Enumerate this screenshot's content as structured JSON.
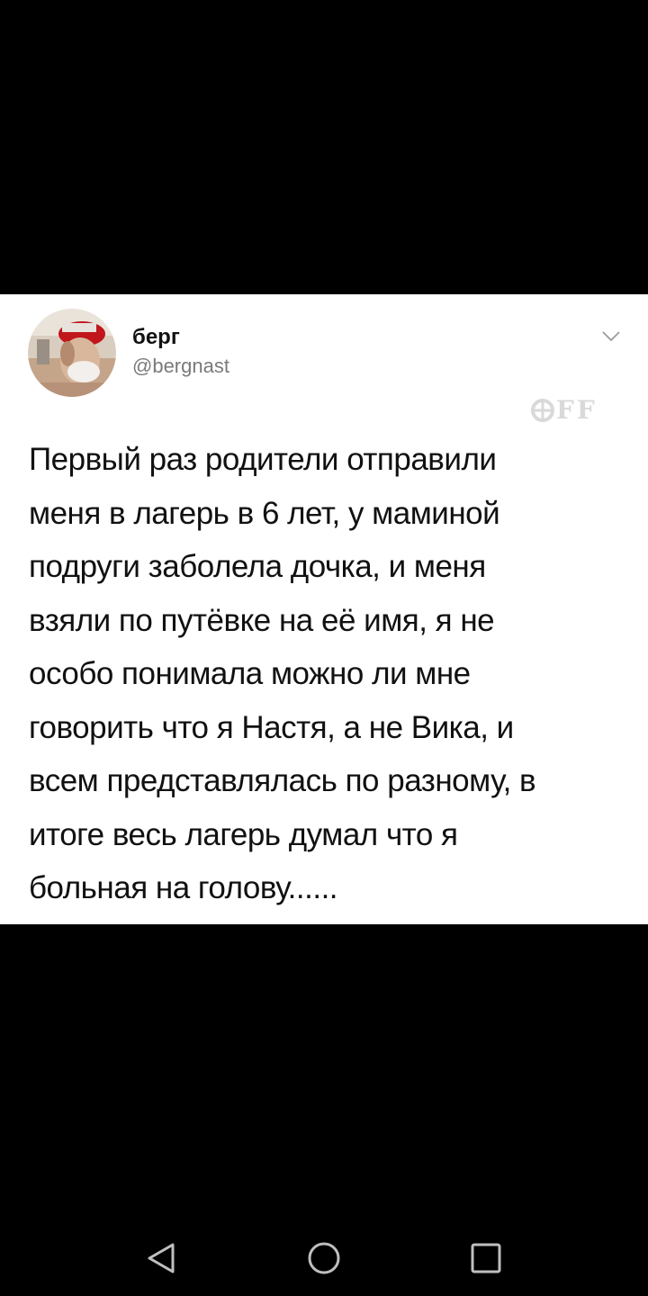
{
  "tweet": {
    "author_name": "берг",
    "author_handle": "@bergnast",
    "watermark": "FF",
    "text_lines": [
      "Первый раз родители отправили",
      "меня в лагерь в 6 лет, у маминой",
      "подруги заболела дочка, и меня",
      "взяли по путёвке на её имя, я не",
      "особо понимала можно ли мне",
      "говорить что я Настя, а не Вика, и",
      "всем представлялась по разному, в",
      "итоге весь лагерь думал что я",
      "больная на голову......"
    ]
  },
  "icons": {
    "more": "chevron-down-icon",
    "back": "back-triangle-icon",
    "home": "home-circle-icon",
    "recents": "recents-square-icon"
  },
  "colors": {
    "background": "#000000",
    "card": "#ffffff",
    "text": "#111111",
    "handle": "#7a7a7a",
    "nav_icons": "#bfbfbf"
  }
}
